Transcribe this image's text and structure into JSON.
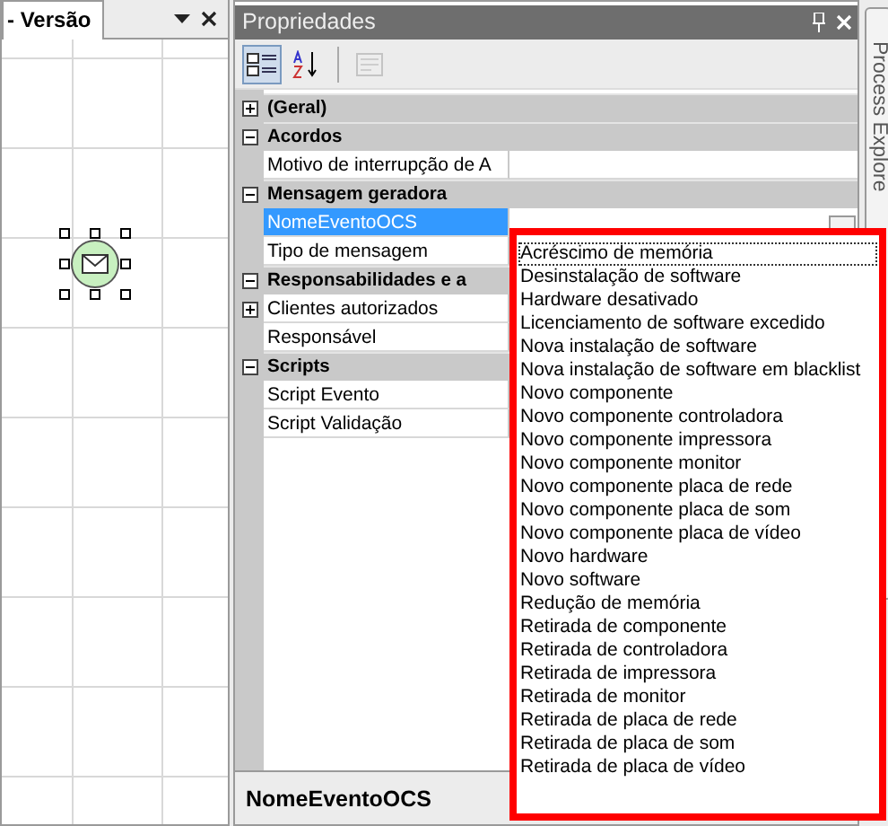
{
  "left_panel": {
    "tab_title": "- Versão"
  },
  "properties": {
    "title": "Propriedades",
    "toolbar": [
      {
        "kind": "categorized",
        "selected": true
      },
      {
        "kind": "alphabetical",
        "selected": false
      },
      {
        "kind": "pages",
        "selected": false,
        "disabled": true
      }
    ],
    "grid": [
      {
        "label": "(Geral)",
        "expanded": false
      },
      {
        "label": "Acordos",
        "expanded": true,
        "children": [
          {
            "label": "Motivo de interrupção de A",
            "selected": false
          }
        ]
      },
      {
        "label": "Mensagem geradora",
        "expanded": true,
        "children": [
          {
            "label": "NomeEventoOCS",
            "selected": true
          },
          {
            "label": "Tipo de mensagem",
            "selected": false
          }
        ]
      },
      {
        "label": "Responsabilidades e a",
        "expanded": true,
        "children": [
          {
            "label": "Clientes autorizados",
            "selected": false,
            "expanded": false
          },
          {
            "label": "Responsável",
            "selected": false
          }
        ]
      },
      {
        "label": "Scripts",
        "expanded": true,
        "children": [
          {
            "label": "Script Evento",
            "selected": false
          },
          {
            "label": "Script Validação",
            "selected": false
          }
        ]
      }
    ],
    "dropdown": {
      "options": [
        {
          "label": "Acréscimo de memória",
          "focused": true
        },
        {
          "label": "Desinstalação de software",
          "focused": false
        },
        {
          "label": "Hardware desativado",
          "focused": false
        },
        {
          "label": "Licenciamento de software excedido",
          "focused": false
        },
        {
          "label": "Nova instalação de software",
          "focused": false
        },
        {
          "label": "Nova instalação de software em blacklist",
          "focused": false
        },
        {
          "label": "Novo componente",
          "focused": false
        },
        {
          "label": "Novo componente controladora",
          "focused": false
        },
        {
          "label": "Novo componente impressora",
          "focused": false
        },
        {
          "label": "Novo componente monitor",
          "focused": false
        },
        {
          "label": "Novo componente placa de rede",
          "focused": false
        },
        {
          "label": "Novo componente placa de som",
          "focused": false
        },
        {
          "label": "Novo componente placa de vídeo",
          "focused": false
        },
        {
          "label": "Novo hardware",
          "focused": false
        },
        {
          "label": "Novo software",
          "focused": false
        },
        {
          "label": "Redução de memória",
          "focused": false
        },
        {
          "label": "Retirada de componente",
          "focused": false
        },
        {
          "label": "Retirada de controladora",
          "focused": false
        },
        {
          "label": "Retirada de impressora",
          "focused": false
        },
        {
          "label": "Retirada de monitor",
          "focused": false
        },
        {
          "label": "Retirada de placa de rede",
          "focused": false
        },
        {
          "label": "Retirada de placa de som",
          "focused": false
        },
        {
          "label": "Retirada de placa de vídeo",
          "focused": false
        }
      ]
    },
    "description": {
      "title": "NomeEventoOCS"
    }
  },
  "side_tab": {
    "label": "Process Explore"
  }
}
